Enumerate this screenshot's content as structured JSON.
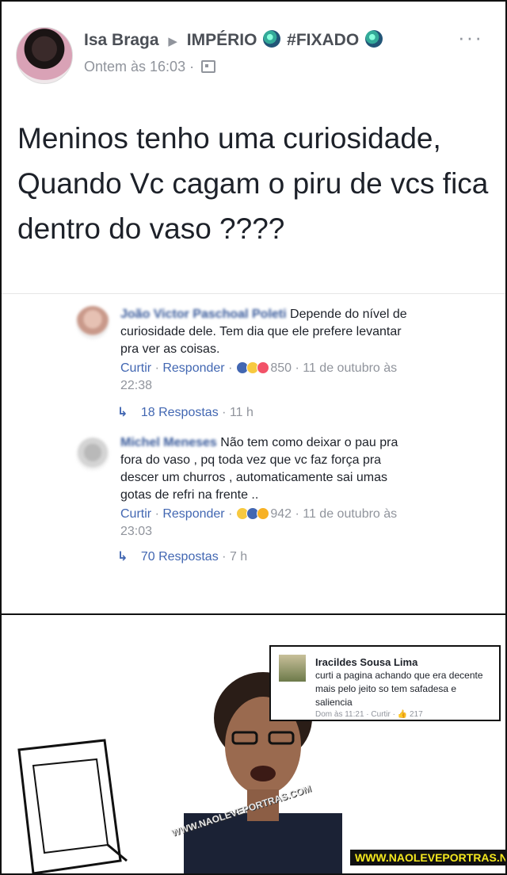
{
  "post": {
    "author": "Isa Braga",
    "group": "IMPÉRIO",
    "group_tag": "#FIXADO",
    "time": "Ontem às 16:03",
    "text": "Meninos tenho uma curiosidade, Quando Vc cagam o piru de vcs fica dentro do vaso ????"
  },
  "comments": [
    {
      "name": "João Victor Paschoal Poleti",
      "text": "Depende do nível de curiosidade dele. Tem dia que ele prefere levantar pra ver as coisas.",
      "like_label": "Curtir",
      "reply_label": "Responder",
      "reaction_count": "850",
      "date": "11 de outubro às 22:38",
      "replies_label": "18 Respostas",
      "replies_time": "11 h"
    },
    {
      "name": "Michel Meneses",
      "text": "Não tem como deixar o pau pra fora do vaso , pq toda vez que vc faz força pra descer um churros , automaticamente sai umas gotas de refri na frente ..",
      "like_label": "Curtir",
      "reply_label": "Responder",
      "reaction_count": "942",
      "date": "11 de outubro às 23:03",
      "replies_label": "70 Respostas",
      "replies_time": "7 h"
    }
  ],
  "meme": {
    "inset_name": "Iracildes Sousa Lima",
    "inset_text": "curti a pagina achando que era decente mais pelo jeito so tem safadesa e saliencia",
    "inset_time": "Dom às 11:21",
    "inset_like": "Curtir",
    "inset_count": "217",
    "watermark": "WWW.NAOLEVEPORTRAS.COM",
    "site_badge": "WWW.NAOLEVEPORTRAS.NET"
  },
  "colors": {
    "link": "#4267b2",
    "name": "#365899",
    "meta": "#90949c",
    "badge_text": "#f4e81e"
  }
}
